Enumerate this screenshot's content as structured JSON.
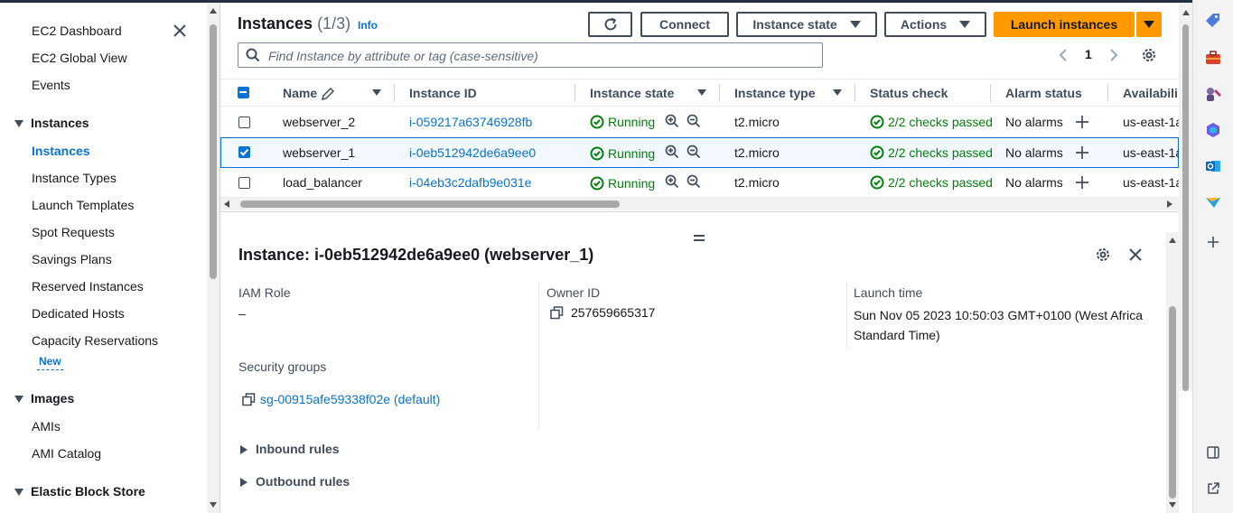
{
  "sidebar": {
    "top_links": [
      "EC2 Dashboard",
      "EC2 Global View",
      "Events"
    ],
    "sections": [
      {
        "title": "Instances",
        "items": [
          "Instances",
          "Instance Types",
          "Launch Templates",
          "Spot Requests",
          "Savings Plans",
          "Reserved Instances",
          "Dedicated Hosts",
          "Capacity Reservations"
        ],
        "active": "Instances",
        "badge": "New"
      },
      {
        "title": "Images",
        "items": [
          "AMIs",
          "AMI Catalog"
        ]
      },
      {
        "title": "Elastic Block Store",
        "items": []
      }
    ]
  },
  "header": {
    "title": "Instances",
    "count": "(1/3)",
    "info": "Info",
    "buttons": {
      "refresh": "refresh-icon",
      "connect": "Connect",
      "instance_state": "Instance state",
      "actions": "Actions",
      "launch": "Launch instances"
    }
  },
  "search": {
    "placeholder": "Find Instance by attribute or tag (case-sensitive)"
  },
  "pagination": {
    "page": "1"
  },
  "table": {
    "columns": [
      "Name",
      "Instance ID",
      "Instance state",
      "Instance type",
      "Status check",
      "Alarm status",
      "Availabili"
    ],
    "rows": [
      {
        "name": "webserver_2",
        "id": "i-059217a63746928fb",
        "state": "Running",
        "type": "t2.micro",
        "status": "2/2 checks passed",
        "alarm": "No alarms",
        "az": "us-east-1a",
        "selected": false
      },
      {
        "name": "webserver_1",
        "id": "i-0eb512942de6a9ee0",
        "state": "Running",
        "type": "t2.micro",
        "status": "2/2 checks passed",
        "alarm": "No alarms",
        "az": "us-east-1a",
        "selected": true
      },
      {
        "name": "load_balancer",
        "id": "i-04eb3c2dafb9e031e",
        "state": "Running",
        "type": "t2.micro",
        "status": "2/2 checks passed",
        "alarm": "No alarms",
        "az": "us-east-1a",
        "selected": false
      }
    ]
  },
  "detail": {
    "title": "Instance: i-0eb512942de6a9ee0 (webserver_1)",
    "iam_role_label": "IAM Role",
    "iam_role_value": "–",
    "owner_label": "Owner ID",
    "owner_value": "257659665317",
    "launch_label": "Launch time",
    "launch_value": "Sun Nov 05 2023 10:50:03 GMT+0100 (West Africa Standard Time)",
    "sg_label": "Security groups",
    "sg_value": "sg-00915afe59338f02e (default)",
    "inbound": "Inbound rules",
    "outbound": "Outbound rules"
  },
  "colors": {
    "primary": "#ff9900",
    "link": "#0972d3",
    "success": "#037f0c",
    "text": "#16191f"
  }
}
